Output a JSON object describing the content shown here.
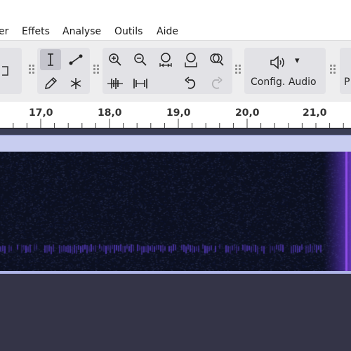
{
  "menu": {
    "items": [
      {
        "id": "edition-partial",
        "label": "er"
      },
      {
        "id": "effets",
        "label": "Effets"
      },
      {
        "id": "analyse",
        "label": "Analyse"
      },
      {
        "id": "outils",
        "label": "Outils"
      },
      {
        "id": "aide",
        "label": "Aide"
      }
    ]
  },
  "toolbar": {
    "tools": {
      "selection": "selection-tool-icon",
      "envelope": "envelope-tool-icon",
      "draw": "draw-pencil-icon",
      "multi": "multi-tool-icon"
    },
    "zoom": {
      "zoom_in": "zoom-in-icon",
      "zoom_out": "zoom-out-icon",
      "fit_selection": "zoom-selection-icon",
      "fit_project": "zoom-fit-icon",
      "zoom_toggle": "zoom-toggle-icon",
      "trim": "trim-audio-icon",
      "silence": "silence-audio-icon",
      "undo": "undo-icon",
      "redo": "redo-icon"
    },
    "audio_setup": {
      "label": "Config. Audio",
      "icon": "speaker-icon",
      "dropdown": "▾"
    },
    "next_group_label": "P"
  },
  "timeline": {
    "ticks": [
      "17,0",
      "18,0",
      "19,0",
      "20,0",
      "21,0"
    ]
  },
  "colors": {
    "menubar": "#ffffff",
    "toolbar": "#eeeeef",
    "track_header": "#c8cdf0",
    "spectrogram_bg": "#0d1120",
    "empty_area": "#343447",
    "accent_purple": "#5b3fc6"
  }
}
